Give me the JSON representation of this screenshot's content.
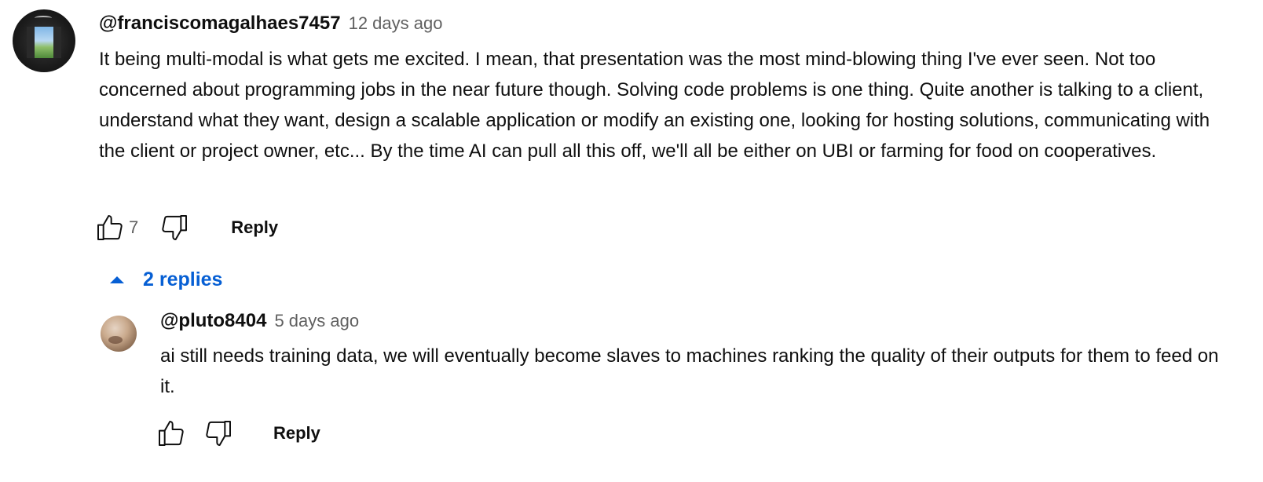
{
  "comment": {
    "author": "@franciscomagalhaes7457",
    "time": "12 days ago",
    "text": "It being multi-modal is what gets me excited. I mean, that presentation was the most mind-blowing thing I've ever seen. Not too concerned about programming jobs in the near future though. Solving code problems is one thing. Quite another is talking to a client, understand what they want, design a scalable application or modify an existing one, looking for hosting solutions, communicating with the client or project owner, etc... By the time AI can pull all this off, we'll all be either on UBI or farming for food on cooperatives.",
    "likes": "7",
    "reply_label": "Reply",
    "avatar_icon": "avatar-window-landscape"
  },
  "replies_toggle": {
    "label": "2 replies",
    "icon": "caret-up-icon",
    "color": "#065fd4"
  },
  "reply": {
    "author": "@pluto8404",
    "time": "5 days ago",
    "text": "ai still needs training data, we will eventually become slaves to machines ranking the quality of their outputs for them to feed on it.",
    "reply_label": "Reply",
    "avatar_icon": "avatar-pluto"
  },
  "colors": {
    "text": "#0f0f0f",
    "secondary": "#606060",
    "link": "#065fd4"
  }
}
